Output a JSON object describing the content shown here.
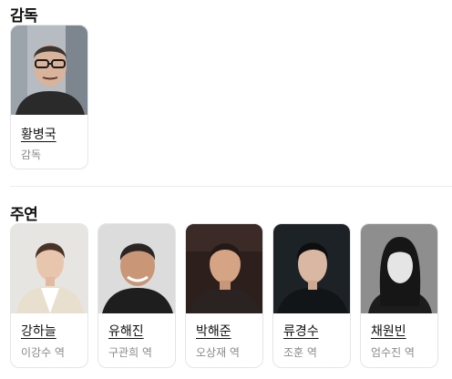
{
  "director_section": {
    "title": "감독"
  },
  "director": {
    "name": "황병국",
    "role": "감독",
    "photo_colors": [
      "#9aa2ab",
      "#2b2b2b"
    ]
  },
  "cast_section": {
    "title": "주연"
  },
  "cast": [
    {
      "name": "강하늘",
      "role": "이강수 역"
    },
    {
      "name": "유해진",
      "role": "구관희 역"
    },
    {
      "name": "박해준",
      "role": "오상재 역"
    },
    {
      "name": "류경수",
      "role": "조훈 역"
    },
    {
      "name": "채원빈",
      "role": "엄수진 역"
    }
  ]
}
